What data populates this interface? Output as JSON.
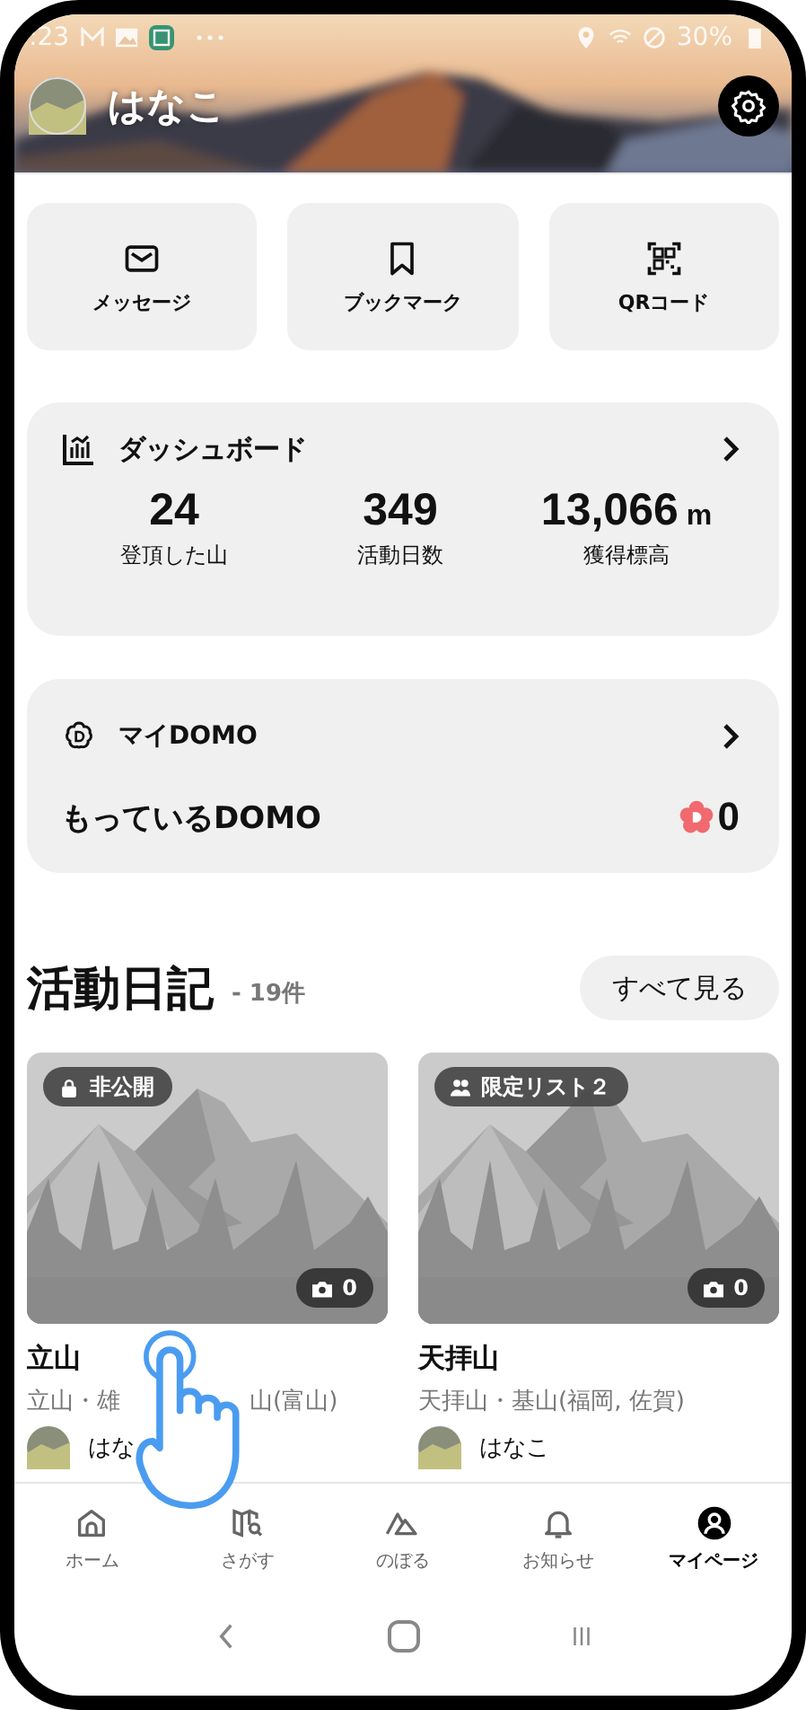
{
  "status_bar": {
    "time": ":23",
    "battery": "30%"
  },
  "profile": {
    "name": "はなこ"
  },
  "quick_actions": [
    {
      "kind": "mail",
      "label": "メッセージ"
    },
    {
      "kind": "bookmark",
      "label": "ブックマーク"
    },
    {
      "kind": "qr",
      "label": "QRコード"
    }
  ],
  "dashboard": {
    "title": "ダッシュボード",
    "stats": [
      {
        "value": "24",
        "label": "登頂した山"
      },
      {
        "value": "349",
        "label": "活動日数"
      },
      {
        "value": "13,066",
        "unit": "m",
        "label": "獲得標高"
      }
    ]
  },
  "domo": {
    "title": "マイDOMO",
    "owned_label": "もっているDOMO",
    "owned_count": "0"
  },
  "diary": {
    "title": "活動日記",
    "count": "- 19件",
    "see_all": "すべて見る",
    "entries": [
      {
        "badge": {
          "kind": "private",
          "label": "非公開"
        },
        "photos": "0",
        "title": "立山",
        "area_parts": [
          "立山・雄",
          "山(富山)"
        ],
        "author": "はな"
      },
      {
        "badge": {
          "kind": "group",
          "label": "限定リスト２"
        },
        "photos": "0",
        "title": "天拝山",
        "area_parts": [
          "天拝山・基山(福岡, 佐賀)"
        ],
        "author": "はなこ"
      }
    ]
  },
  "nav": [
    {
      "kind": "home",
      "label": "ホーム",
      "selected": false
    },
    {
      "kind": "map",
      "label": "さがす",
      "selected": false
    },
    {
      "kind": "climb",
      "label": "のぼる",
      "selected": false
    },
    {
      "kind": "bell",
      "label": "お知らせ",
      "selected": false
    },
    {
      "kind": "user",
      "label": "マイページ",
      "selected": true
    }
  ]
}
